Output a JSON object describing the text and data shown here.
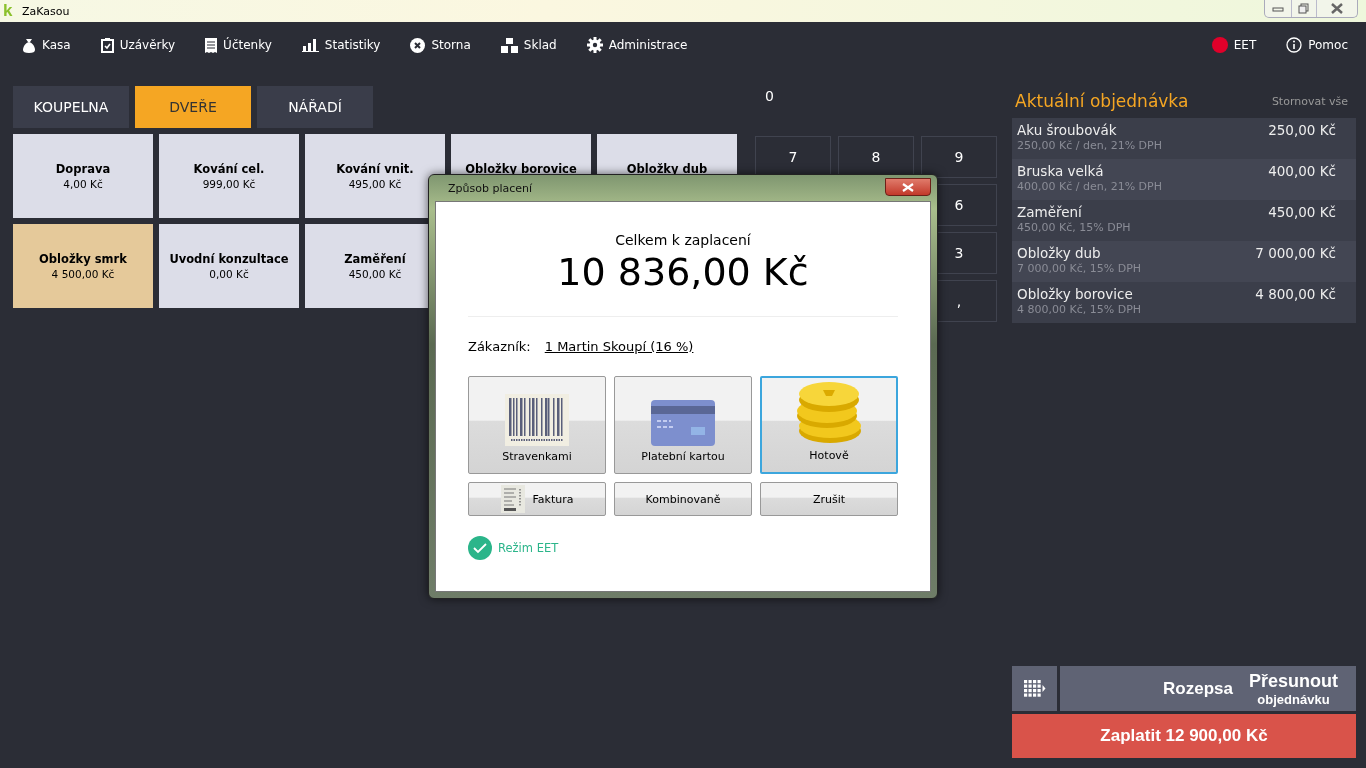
{
  "window": {
    "logo": "k",
    "title": "ZaKasou"
  },
  "menu": [
    {
      "label": "Kasa",
      "kind": "moneybag"
    },
    {
      "label": "Uzávěrky",
      "kind": "clipboard"
    },
    {
      "label": "Účtenky",
      "kind": "receipt"
    },
    {
      "label": "Statistiky",
      "kind": "chart"
    },
    {
      "label": "Storna",
      "kind": "cancel"
    },
    {
      "label": "Sklad",
      "kind": "boxes"
    },
    {
      "label": "Administrace",
      "kind": "gear"
    }
  ],
  "eet_status": {
    "label": "EET",
    "online": false
  },
  "help": {
    "label": "Pomoc"
  },
  "tabs": [
    {
      "label": "KOUPELNA",
      "selected": false
    },
    {
      "label": "DVEŘE",
      "selected": true
    },
    {
      "label": "NÁŘADÍ",
      "selected": false
    }
  ],
  "products": [
    {
      "name": "Doprava",
      "price": "4,00 Kč",
      "selected": false
    },
    {
      "name": "Kování cel.",
      "price": "999,00 Kč",
      "selected": false
    },
    {
      "name": "Kování vnit.",
      "price": "495,00 Kč",
      "selected": false
    },
    {
      "name": "Obložky borovice",
      "selected": false
    },
    {
      "name": "Obložky dub",
      "selected": false
    },
    {
      "name": "Obložky smrk",
      "price": "4 500,00 Kč",
      "selected": true
    },
    {
      "name": "Uvodní konzultace",
      "price": "0,00 Kč",
      "selected": false
    },
    {
      "name": "Zaměření",
      "price": "450,00 Kč",
      "selected": false
    }
  ],
  "numpad": {
    "display": "0",
    "rows": [
      [
        "7",
        "8",
        "9"
      ],
      [
        "6"
      ],
      [
        "3"
      ],
      [
        ","
      ]
    ]
  },
  "order": {
    "title": "Aktuální objednávka",
    "clear_all": "Stornovat vše",
    "items": [
      {
        "name": "Aku šroubovák",
        "price": "250,00 Kč",
        "detail": "250,00 Kč / den, 21% DPH"
      },
      {
        "name": "Bruska velká",
        "price": "400,00 Kč",
        "detail": "400,00 Kč / den, 21% DPH"
      },
      {
        "name": "Zaměření",
        "price": "450,00 Kč",
        "detail": "450,00 Kč, 15% DPH"
      },
      {
        "name": "Obložky dub",
        "price": "7 000,00 Kč",
        "detail": "7 000,00 Kč, 15% DPH"
      },
      {
        "name": "Obložky borovice",
        "price": "4 800,00 Kč",
        "detail": "4 800,00 Kč, 15% DPH"
      }
    ]
  },
  "actions": {
    "split": "Rozepsa",
    "move_title": "Přesunout",
    "move_subtitle": "objednávku",
    "pay": "Zaplatit 12 900,00 Kč"
  },
  "dialog": {
    "title": "Způsob placení",
    "total_label": "Celkem k zaplacení",
    "total": "10 836,00 Kč",
    "customer_label": "Zákazník:",
    "customer": "1 Martin Skoupí (16 %)",
    "methods": [
      {
        "label": "Stravenkami",
        "kind": "barcode",
        "selected": false
      },
      {
        "label": "Platební kartou",
        "kind": "card",
        "selected": false
      },
      {
        "label": "Hotově",
        "kind": "coins",
        "selected": true
      }
    ],
    "options": [
      {
        "label": "Faktura",
        "kind": "invoice"
      },
      {
        "label": "Kombinovaně",
        "kind": "plain"
      },
      {
        "label": "Zrušit",
        "kind": "plain"
      }
    ],
    "eet_mode": {
      "label": "Režim EET",
      "on": true
    }
  }
}
